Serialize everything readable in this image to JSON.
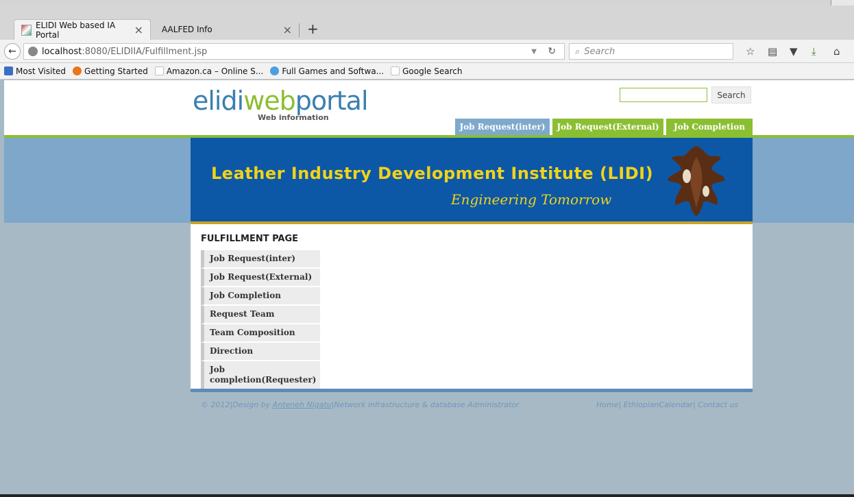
{
  "browser": {
    "tabs": [
      {
        "label": "ELIDI Web based IA Portal",
        "active": true
      },
      {
        "label": "AALFED Info",
        "active": false
      }
    ],
    "url_host": "localhost",
    "url_path": ":8080/ELIDIIA/Fulfillment.jsp",
    "search_placeholder": "Search",
    "bookmarks": [
      "Most Visited",
      "Getting Started",
      "Amazon.ca – Online S...",
      "Full Games and Softwa...",
      "Google Search"
    ]
  },
  "site": {
    "logo": {
      "part1": "elidi",
      "part2": "web",
      "part3": "portal",
      "subtitle": "Web information"
    },
    "search_button": "Search",
    "nav_tabs": [
      "Job Request(inter)",
      "Job Request(External)",
      "Job Completion"
    ],
    "banner_title": "Leather Industry Development Institute (LIDI)",
    "banner_tagline": "Engineering Tomorrow",
    "page_title": "FULFILLMENT PAGE",
    "side_menu": [
      "Job Request(inter)",
      "Job Request(External)",
      "Job Completion",
      "Request Team",
      "Team Composition",
      "Direction",
      "Job completion(Requester)"
    ],
    "footer_left_prefix": "© 2012|Design by ",
    "footer_author": "Anteneh Nigatu",
    "footer_left_suffix": "|Network infrastructure & database Administrator",
    "footer_links": [
      "Home|",
      "EthiopianCalendar|",
      "Contact us"
    ]
  }
}
